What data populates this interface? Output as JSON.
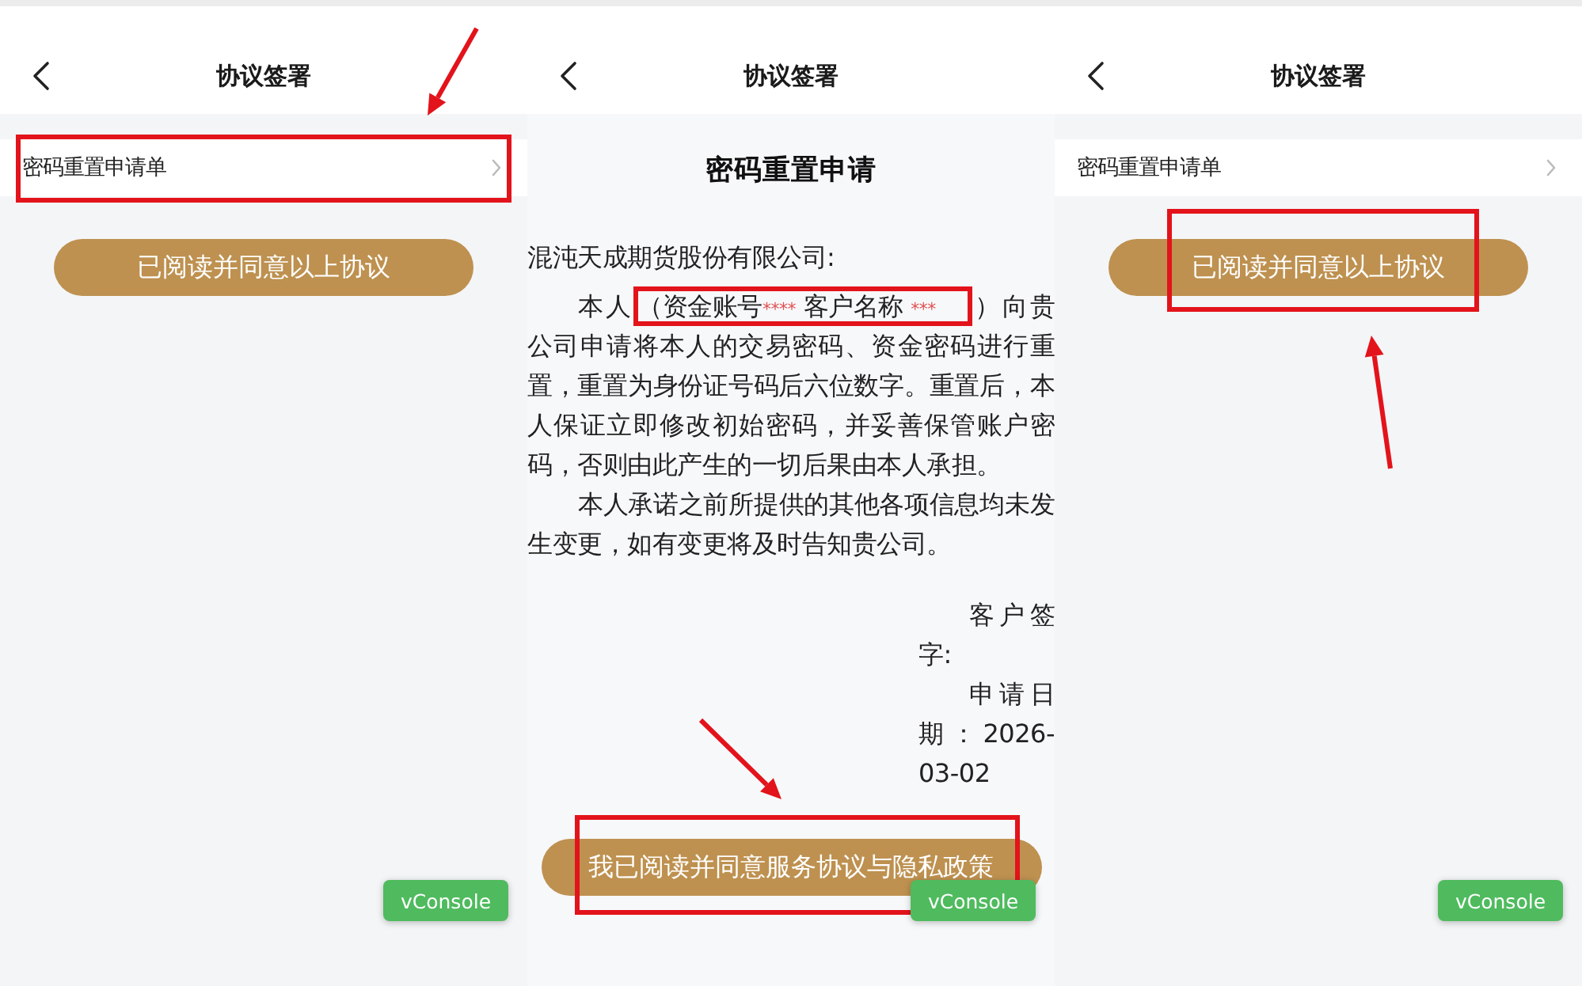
{
  "panels": [
    {
      "kind": "agreement_list",
      "header": {
        "title": "协议签署"
      },
      "agreements": [
        {
          "label": "密码重置申请单",
          "highlighted": true,
          "arrow": true
        }
      ],
      "agree_button": {
        "label": "已阅读并同意以上协议",
        "highlighted": false,
        "arrow": false
      },
      "vconsole": "vConsole"
    },
    {
      "kind": "document",
      "header": {
        "title": "协议签署"
      },
      "document": {
        "title": "密码重置申请",
        "salutation": "混沌天成期货股份有限公司:",
        "paragraphs": [
          {
            "parts": [
              {
                "kind": "plain",
                "text": "本人"
              },
              {
                "kind": "annotated",
                "parts": [
                  {
                    "kind": "plain",
                    "text": "（资金账号"
                  },
                  {
                    "kind": "masked",
                    "text": "****"
                  },
                  {
                    "kind": "plain",
                    "text": " 客户名称 "
                  },
                  {
                    "kind": "masked",
                    "text": "***"
                  }
                ]
              },
              {
                "kind": "plain",
                "text": "）向贵公司申请将本人的交易密码、资金密码进行重置，重置为身份证号码后六位数字。重置后，本人保证立即修改初始密码，并妥善保管账户密码，否则由此产生的一切后果由本人承担。"
              }
            ]
          },
          {
            "parts": [
              {
                "kind": "plain",
                "text": "本人承诺之前所提供的其他各项信息均未发生变更，如有变更将及时告知贵公司。"
              }
            ]
          }
        ],
        "signature_lines": [
          "客户签字:",
          "申请日期：2026-03-02"
        ]
      },
      "agree_button": {
        "label": "我已阅读并同意服务协议与隐私政策",
        "highlighted": true,
        "arrow": true
      },
      "vconsole": "vConsole"
    },
    {
      "kind": "agreement_list",
      "header": {
        "title": "协议签署"
      },
      "agreements": [
        {
          "label": "密码重置申请单",
          "highlighted": false,
          "arrow": false
        }
      ],
      "agree_button": {
        "label": "已阅读并同意以上协议",
        "highlighted": true,
        "arrow": true
      },
      "vconsole": "vConsole"
    }
  ]
}
